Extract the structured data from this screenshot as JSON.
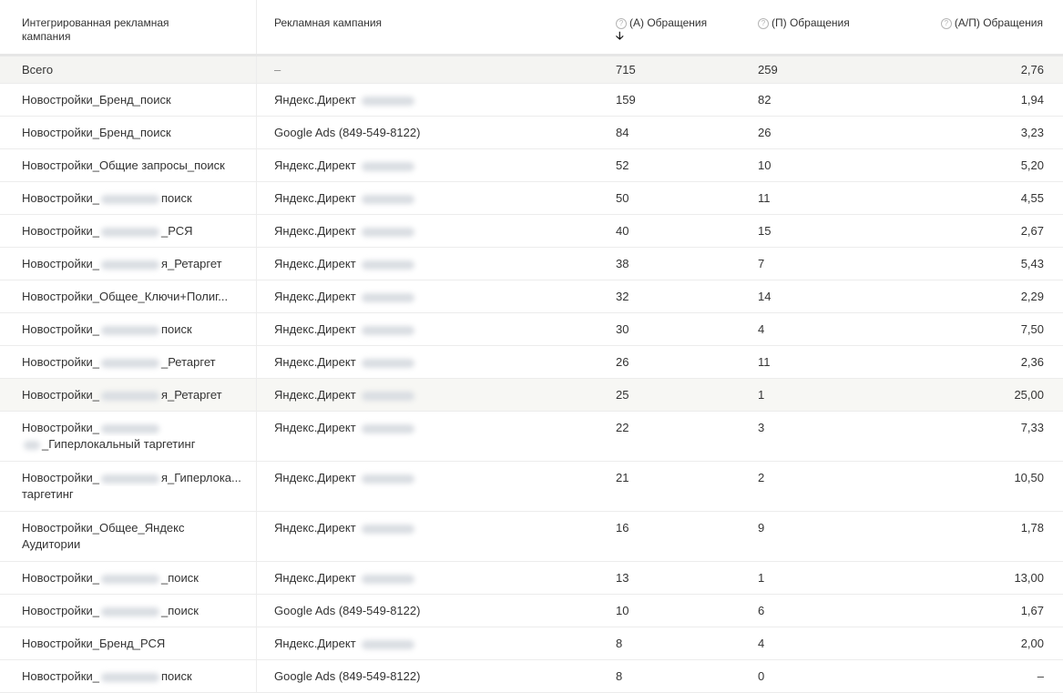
{
  "headers": {
    "integrated": "Интегрированная рекламная кампания",
    "campaign": "Рекламная кампания",
    "a_label": "(А) Обращения",
    "p_label": "(П) Обращения",
    "ap_label": "(А/П) Обращения",
    "help_glyph": "?",
    "sort_glyph": "🡣"
  },
  "total": {
    "label": "Всего",
    "campaign": "–",
    "a": "715",
    "p": "259",
    "ap": "2,76"
  },
  "rows": [
    {
      "pre": "Новостройки_Бренд_поиск",
      "post": "",
      "c_text": "Яндекс.Директ",
      "a": "159",
      "p": "82",
      "ap": "1,94"
    },
    {
      "pre": "Новостройки_Бренд_поиск",
      "post": "",
      "c_text": "Google Ads (849-549-8122)",
      "a": "84",
      "p": "26",
      "ap": "3,23"
    },
    {
      "pre": "Новостройки_Общие запросы_поиск",
      "post": "",
      "c_text": "Яндекс.Директ",
      "a": "52",
      "p": "10",
      "ap": "5,20"
    },
    {
      "pre": "Новостройки_",
      "post": "поиск",
      "c_text": "Яндекс.Директ",
      "a": "50",
      "p": "11",
      "ap": "4,55"
    },
    {
      "pre": "Новостройки_",
      "post": "_РСЯ",
      "c_text": "Яндекс.Директ",
      "a": "40",
      "p": "15",
      "ap": "2,67"
    },
    {
      "pre": "Новостройки_",
      "post": "я_Ретаргет",
      "c_text": "Яндекс.Директ",
      "a": "38",
      "p": "7",
      "ap": "5,43"
    },
    {
      "pre": "Новостройки_Общее_Ключи+Полиг...",
      "post": "",
      "c_text": "Яндекс.Директ",
      "a": "32",
      "p": "14",
      "ap": "2,29"
    },
    {
      "pre": "Новостройки_",
      "post": "поиск",
      "c_text": "Яндекс.Директ",
      "a": "30",
      "p": "4",
      "ap": "7,50"
    },
    {
      "pre": "Новостройки_",
      "post": "_Ретаргет",
      "c_text": "Яндекс.Директ",
      "a": "26",
      "p": "11",
      "ap": "2,36"
    },
    {
      "pre": "Новостройки_",
      "post": "я_Ретаргет",
      "c_text": "Яндекс.Директ",
      "a": "25",
      "p": "1",
      "ap": "25,00"
    },
    {
      "pre": "Новостройки_",
      "post": "",
      "line2": "_Гиперлокальный таргетинг",
      "c_text": "Яндекс.Директ",
      "a": "22",
      "p": "3",
      "ap": "7,33"
    },
    {
      "pre": "Новостройки_",
      "post": "я_Гиперлока...",
      "line2": "таргетинг",
      "c_text": "Яндекс.Директ",
      "a": "21",
      "p": "2",
      "ap": "10,50"
    },
    {
      "pre": "Новостройки_Общее_Яндекс",
      "post": "",
      "line2": "Аудитории",
      "c_text": "Яндекс.Директ",
      "a": "16",
      "p": "9",
      "ap": "1,78"
    },
    {
      "pre": "Новостройки_",
      "post": "_поиск",
      "c_text": "Яндекс.Директ",
      "a": "13",
      "p": "1",
      "ap": "13,00"
    },
    {
      "pre": "Новостройки_",
      "post": "_поиск",
      "c_text": "Google Ads (849-549-8122)",
      "a": "10",
      "p": "6",
      "ap": "1,67"
    },
    {
      "pre": "Новостройки_Бренд_РСЯ",
      "post": "",
      "c_text": "Яндекс.Директ",
      "a": "8",
      "p": "4",
      "ap": "2,00"
    },
    {
      "pre": "Новостройки_",
      "post": "поиск",
      "c_text": "Google Ads (849-549-8122)",
      "a": "8",
      "p": "0",
      "ap": "–"
    }
  ]
}
